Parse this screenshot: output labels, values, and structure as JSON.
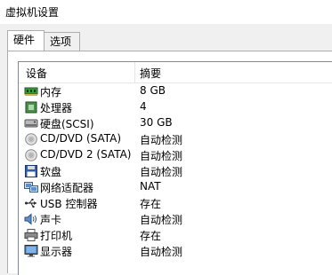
{
  "window": {
    "title": "虚拟机设置"
  },
  "tabs": [
    {
      "label": "硬件",
      "active": true
    },
    {
      "label": "选项",
      "active": false
    }
  ],
  "device_list": {
    "columns": [
      "设备",
      "摘要"
    ],
    "rows": [
      {
        "icon": "memory-icon",
        "device": "内存",
        "summary": "8 GB"
      },
      {
        "icon": "processor-icon",
        "device": "处理器",
        "summary": "4"
      },
      {
        "icon": "hard-disk-icon",
        "device": "硬盘(SCSI)",
        "summary": "30 GB"
      },
      {
        "icon": "cd-dvd-icon",
        "device": "CD/DVD (SATA)",
        "summary": "自动检测"
      },
      {
        "icon": "cd-dvd-icon",
        "device": "CD/DVD 2 (SATA)",
        "summary": "自动检测"
      },
      {
        "icon": "floppy-icon",
        "device": "软盘",
        "summary": "自动检测"
      },
      {
        "icon": "network-adapter-icon",
        "device": "网络适配器",
        "summary": "NAT"
      },
      {
        "icon": "usb-icon",
        "device": "USB 控制器",
        "summary": "存在"
      },
      {
        "icon": "sound-card-icon",
        "device": "声卡",
        "summary": "自动检测"
      },
      {
        "icon": "printer-icon",
        "device": "打印机",
        "summary": "存在"
      },
      {
        "icon": "display-icon",
        "device": "显示器",
        "summary": "自动检测"
      }
    ]
  }
}
